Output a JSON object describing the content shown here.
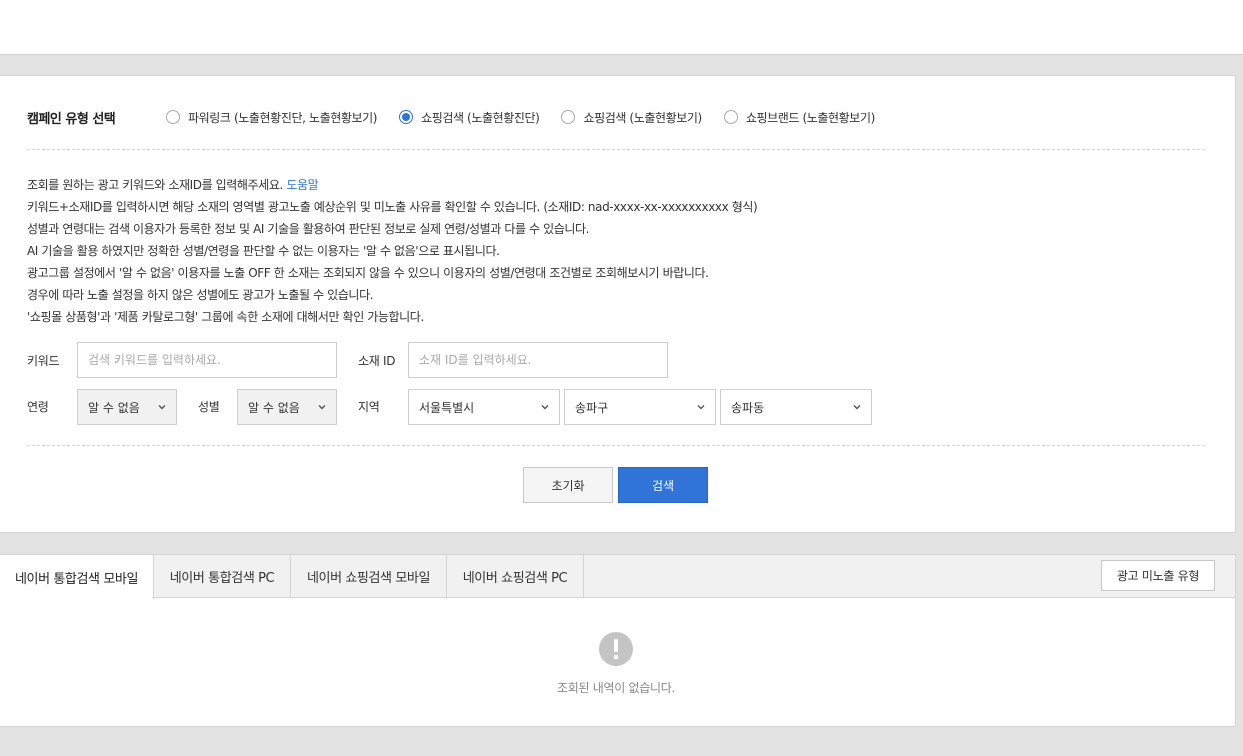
{
  "campaign": {
    "title": "캠페인 유형 선택",
    "options": [
      {
        "label": "파워링크 (노출현황진단, 노출현황보기)",
        "selected": false
      },
      {
        "label": "쇼핑검색 (노출현황진단)",
        "selected": true
      },
      {
        "label": "쇼핑검색 (노출현황보기)",
        "selected": false
      },
      {
        "label": "쇼핑브랜드 (노출현황보기)",
        "selected": false
      }
    ]
  },
  "info": {
    "line1": "조회를 원하는 광고 키워드와 소재ID를 입력해주세요.",
    "help_link": "도움말",
    "line2": "키워드+소재ID를 입력하시면 해당 소재의 영역별 광고노출 예상순위 및 미노출 사유를 확인할 수 있습니다. (소재ID: nad-xxxx-xx-xxxxxxxxxx 형식)",
    "line3": "성별과 연령대는 검색 이용자가 등록한 정보 및 AI 기술을 활용하여 판단된 정보로 실제 연령/성별과 다를 수 있습니다.",
    "line4": "AI 기술을 활용 하였지만 정확한 성별/연령을 판단할 수 없는 이용자는 '알 수 없음'으로 표시됩니다.",
    "line5": "광고그룹 설정에서 '알 수 없음' 이용자를 노출 OFF 한 소재는 조회되지 않을 수 있으니 이용자의 성별/연령대 조건별로 조회해보시기 바랍니다.",
    "line6": "경우에 따라 노출 설정을 하지 않은 성별에도 광고가 노출될 수 있습니다.",
    "line7": "'쇼핑몰 상품형'과 '제품 카탈로그형' 그룹에 속한 소재에 대해서만 확인 가능합니다."
  },
  "form": {
    "keyword_label": "키워드",
    "keyword_placeholder": "검색 키워드를 입력하세요.",
    "ad_id_label": "소재 ID",
    "ad_id_placeholder": "소재 ID를 입력하세요.",
    "age_label": "연령",
    "age_value": "알 수 없음",
    "gender_label": "성별",
    "gender_value": "알 수 없음",
    "region_label": "지역",
    "region1": "서울특별시",
    "region2": "송파구",
    "region3": "송파동"
  },
  "buttons": {
    "reset": "초기화",
    "search": "검색"
  },
  "result": {
    "tabs": [
      {
        "label": "네이버 통합검색 모바일",
        "active": true
      },
      {
        "label": "네이버 통합검색 PC",
        "active": false
      },
      {
        "label": "네이버 쇼핑검색 모바일",
        "active": false
      },
      {
        "label": "네이버 쇼핑검색 PC",
        "active": false
      }
    ],
    "ad_type_button": "광고 미노출 유형",
    "empty_text": "조회된 내역이 없습니다."
  },
  "colors": {
    "accent": "#2f74d6",
    "background": "#e3e3e3"
  }
}
